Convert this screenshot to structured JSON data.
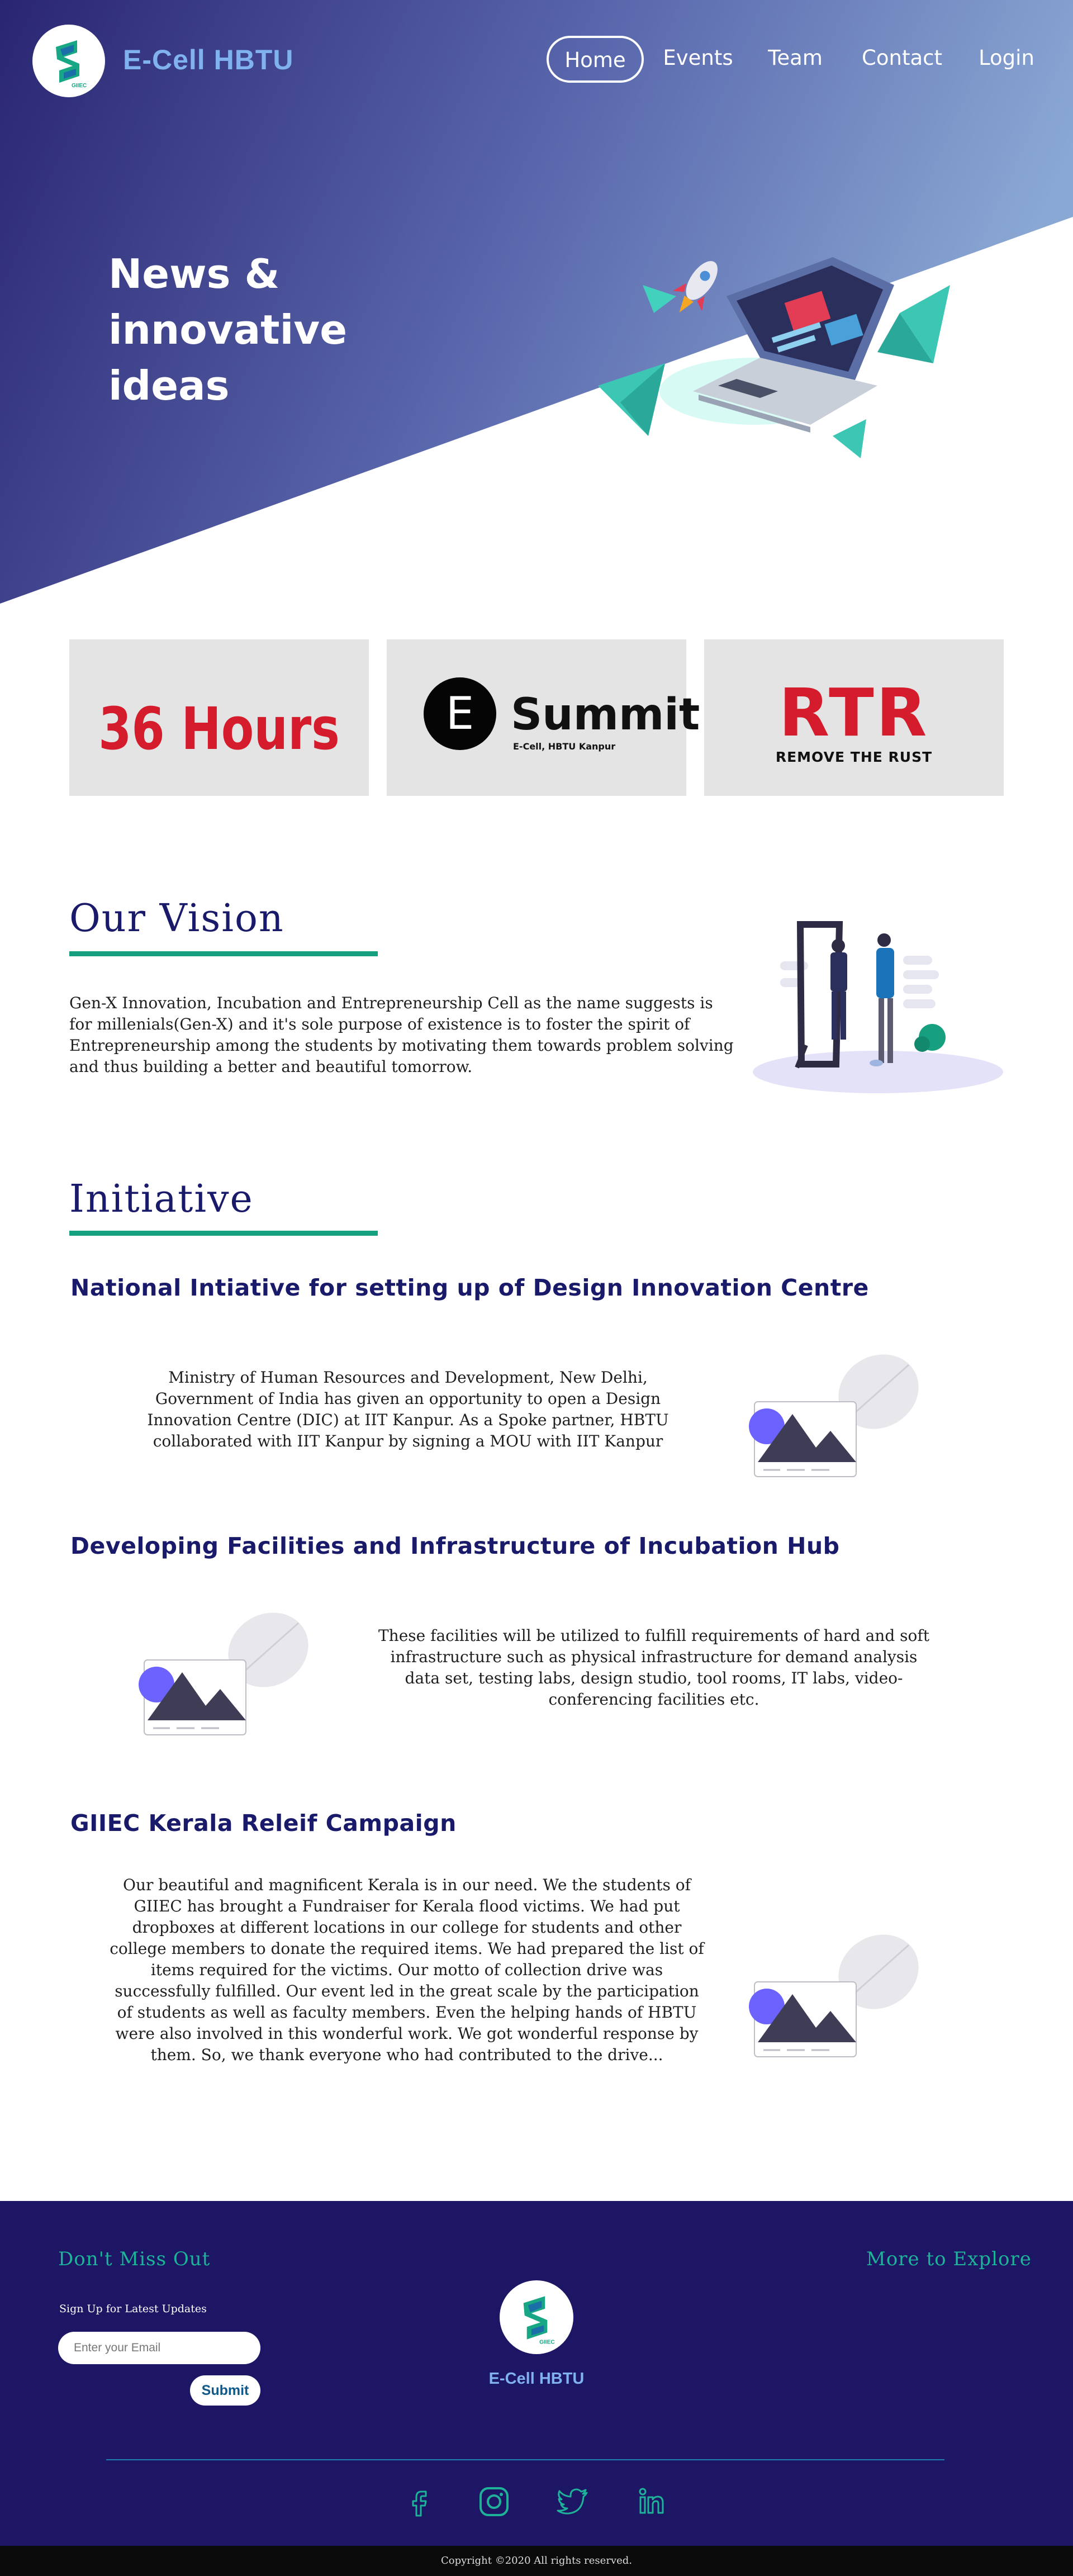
{
  "brand": {
    "name": "E-Cell HBTU"
  },
  "nav": [
    {
      "label": "Home",
      "active": true
    },
    {
      "label": "Events",
      "active": false
    },
    {
      "label": "Team",
      "active": false
    },
    {
      "label": "Contact",
      "active": false
    },
    {
      "label": "Login",
      "active": false
    }
  ],
  "hero": {
    "line1": "News  &",
    "line2": "innovative",
    "line3": "ideas"
  },
  "events": {
    "hours": "36 Hours",
    "summit": {
      "letter": "E",
      "title": "Summit",
      "subtitle": "E-Cell, HBTU Kanpur"
    },
    "rtr": {
      "title": "RTR",
      "subtitle": "REMOVE THE RUST"
    }
  },
  "vision": {
    "title": "Our Vision",
    "text": "Gen-X Innovation, Incubation and Entrepreneurship Cell as the name suggests is for millenials(Gen-X) and it's sole purpose of existence is to foster the spirit of Entrepreneurship among the students by motivating them towards problem solving and thus building a better and beautiful tomorrow."
  },
  "initiative": {
    "title": "Initiative",
    "items": [
      {
        "title": "National Intiative for setting up of Design Innovation Centre",
        "text": "Ministry of Human Resources and Development, New Delhi, Government of India has given an opportunity to open a Design Innovation Centre (DIC) at IIT Kanpur. As a Spoke partner, HBTU collaborated with IIT Kanpur by signing a MOU with IIT Kanpur"
      },
      {
        "title": "Developing Facilities and Infrastructure of Incubation Hub",
        "text": "These facilities will be utilized to fulfill requirements of hard and soft infrastructure such as physical infrastructure for demand analysis data set, testing labs, design studio, tool rooms, IT labs, video-conferencing facilities etc."
      },
      {
        "title": "GIIEC Kerala Releif Campaign",
        "text": "Our beautiful and magnificent Kerala is in our need. We the students of GIIEC has brought a Fundraiser for Kerala flood victims. We had put dropboxes at different locations in our college for students and other college members to donate the required items. We had prepared the list of items required for the victims. Our motto of collection drive was successfully fulfilled. Our event led in the great scale by the participation of students as well as faculty members. Even the helping hands of HBTU were also involved in this wonderful work. We got wonderful response by them. So, we thank everyone who had contributed to the drive..."
      }
    ]
  },
  "footer": {
    "left_heading": "Don't Miss Out",
    "signup_label": "Sign Up for Latest Updates",
    "email_placeholder": "Enter your Email",
    "submit_label": "Submit",
    "right_heading": "More to Explore",
    "brand": "E-Cell HBTU",
    "social": [
      "facebook-icon",
      "instagram-icon",
      "twitter-icon",
      "linkedin-icon"
    ],
    "copyright": "Copyright ©2020 All rights reserved."
  },
  "colors": {
    "hero_dark": "#2a2572",
    "hero_light": "#8aa8d4",
    "accent_green": "#17a080",
    "heading_navy": "#1a1a6a",
    "footer_bg": "#1d1665",
    "event_red": "#d41c2c"
  }
}
